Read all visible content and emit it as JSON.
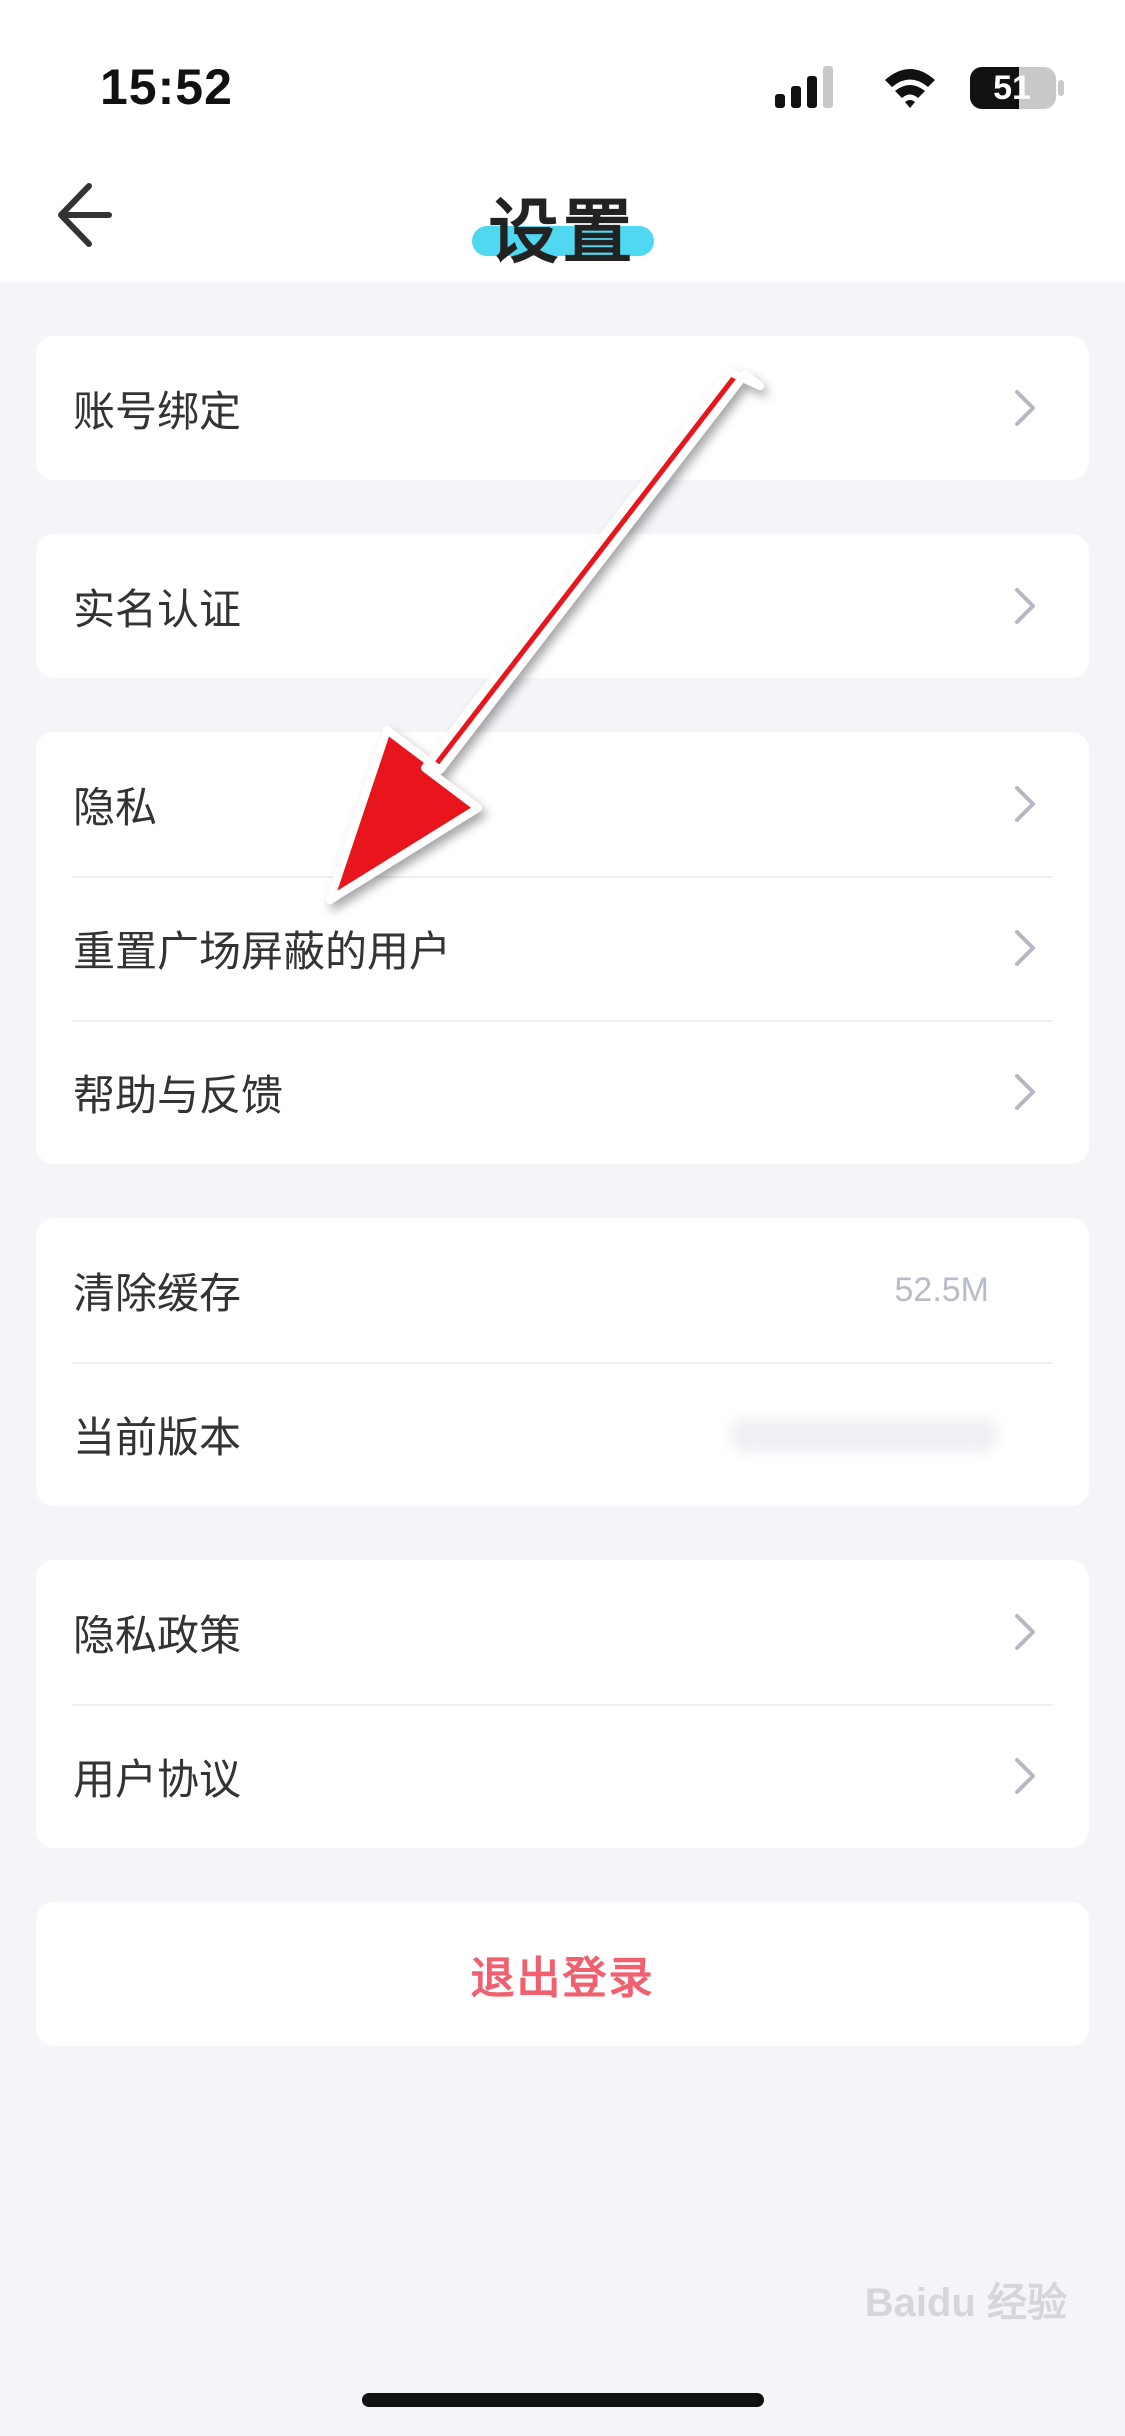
{
  "status_bar": {
    "time": "15:52",
    "battery": "51",
    "icons": [
      "signal-icon",
      "wifi-icon",
      "battery-icon"
    ]
  },
  "header": {
    "title": "设置",
    "back_icon": "back-arrow-icon",
    "title_highlight_color": "#4fd8ef"
  },
  "groups": [
    {
      "items": [
        {
          "label": "账号绑定",
          "icon": "chevron-right-icon"
        }
      ]
    },
    {
      "items": [
        {
          "label": "实名认证",
          "icon": "chevron-right-icon"
        }
      ]
    },
    {
      "items": [
        {
          "label": "隐私",
          "icon": "chevron-right-icon"
        },
        {
          "label": "重置广场屏蔽的用户",
          "icon": "chevron-right-icon"
        },
        {
          "label": "帮助与反馈",
          "icon": "chevron-right-icon"
        }
      ]
    },
    {
      "items": [
        {
          "label": "清除缓存",
          "value": "52.5M"
        },
        {
          "label": "当前版本",
          "value_state": "blurred"
        }
      ]
    },
    {
      "items": [
        {
          "label": "隐私政策",
          "icon": "chevron-right-icon"
        },
        {
          "label": "用户协议",
          "icon": "chevron-right-icon"
        }
      ]
    }
  ],
  "logout": {
    "label": "退出登录",
    "color": "#f0606f"
  },
  "annotation": {
    "icon": "red-arrow-icon",
    "color": "#e8121a"
  },
  "watermark": "Baidu 经验"
}
